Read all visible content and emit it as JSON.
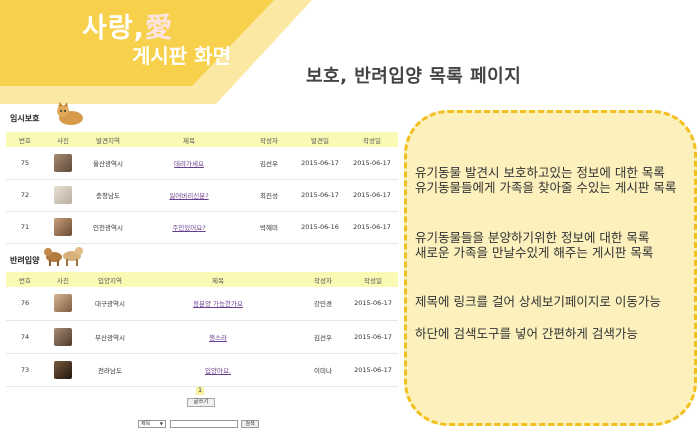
{
  "header": {
    "title_main": "사랑,",
    "title_accent": "愛",
    "title_sub": "게시판 화면",
    "page_title": "보호, 반려입양 목록 페이지"
  },
  "colors": {
    "banner_yellow": "#f7d04c",
    "banner_light": "#fbe9a3",
    "callout_fill": "#fcf0bd",
    "callout_border": "#f2c01e",
    "table_header": "#fafab4"
  },
  "board": {
    "temp_section": {
      "label": "임시보호",
      "columns": [
        "번호",
        "사진",
        "발견지역",
        "제목",
        "작성자",
        "발견일",
        "작성일"
      ],
      "rows": [
        {
          "no": "75",
          "region": "울산광역시",
          "title": "데려가세요",
          "author": "김선우",
          "found": "2015-06-17",
          "written": "2015-06-17"
        },
        {
          "no": "72",
          "region": "충청남도",
          "title": "잃어버리신분?",
          "author": "최진성",
          "found": "2015-06-17",
          "written": "2015-06-17"
        },
        {
          "no": "71",
          "region": "인천광역시",
          "title": "주인있어요?",
          "author": "박혜미",
          "found": "2015-06-16",
          "written": "2015-06-17"
        }
      ]
    },
    "adopt_section": {
      "label": "반려입양",
      "columns": [
        "번호",
        "사진",
        "입양지역",
        "제목",
        "작성자",
        "작성일"
      ],
      "rows": [
        {
          "no": "76",
          "region": "대구광역시",
          "title": "정분양 가능한가요",
          "author": "강민경",
          "written": "2015-06-17"
        },
        {
          "no": "74",
          "region": "부산광역시",
          "title": "행스라",
          "author": "김선우",
          "written": "2015-06-17"
        },
        {
          "no": "73",
          "region": "전라남도",
          "title": "입양아요.",
          "author": "이미나",
          "written": "2015-06-17"
        }
      ]
    },
    "pager": "1",
    "write_button": "글쓰기",
    "search_select": "제목",
    "search_button": "검색"
  },
  "notes": [
    "유기동물 발견시 보호하고있는 정보에 대한 목록",
    "유기동물들에게 가족을 찾아줄 수있는 게시판 목록",
    "유기동물들을 분양하기위한 정보에 대한 목록",
    "새로운 가족을 만날수있게 해주는 게시판 목록",
    "제목에 링크를 걸어 상세보기페이지로 이동가능",
    "하단에 검색도구를 넣어 간편하게 검색가능"
  ]
}
